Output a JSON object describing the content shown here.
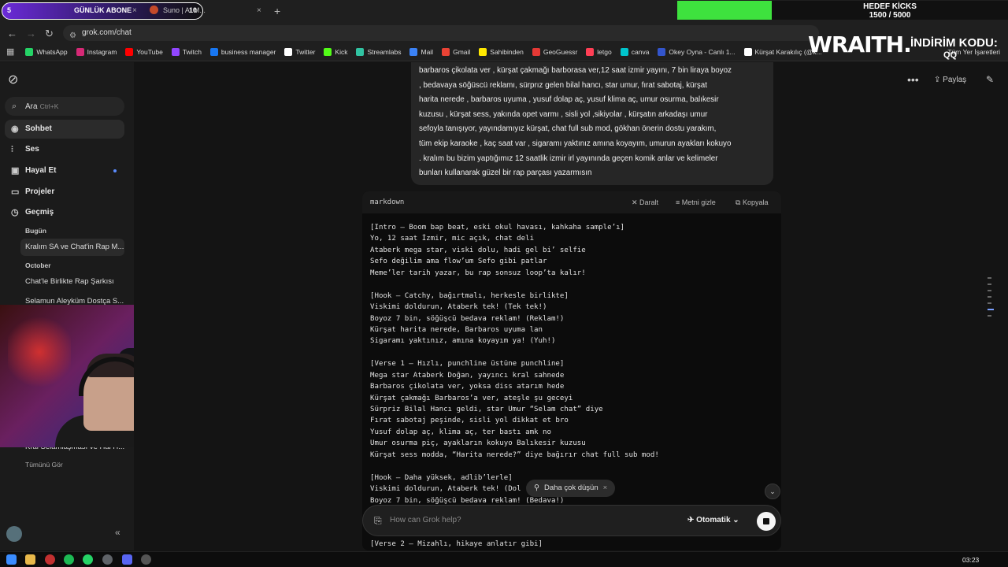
{
  "browser": {
    "tabs": [
      {
        "label": "GÜNLÜK ABONE",
        "count": "5",
        "num": "10"
      },
      {
        "label": "Suno | AI M..."
      }
    ],
    "goal": {
      "title": "HEDEF KİCKS",
      "value": "1500 / 5000",
      "progress": 0.3
    },
    "url": "grok.com/chat",
    "bookmarks": [
      {
        "label": "WhatsApp",
        "icon": "whatsapp-icon",
        "color": "#25d366"
      },
      {
        "label": "Instagram",
        "icon": "instagram-icon",
        "color": "#d62976"
      },
      {
        "label": "YouTube",
        "icon": "youtube-icon",
        "color": "#ff0000"
      },
      {
        "label": "Twitch",
        "icon": "twitch-icon",
        "color": "#9146ff"
      },
      {
        "label": "business manager",
        "icon": "meta-icon",
        "color": "#1877f2"
      },
      {
        "label": "Twitter",
        "icon": "x-icon",
        "color": "#ffffff"
      },
      {
        "label": "Kick",
        "icon": "kick-icon",
        "color": "#53fc18"
      },
      {
        "label": "Streamlabs",
        "icon": "streamlabs-icon",
        "color": "#31c3a2"
      },
      {
        "label": "Mail",
        "icon": "mail-icon",
        "color": "#3b82f6"
      },
      {
        "label": "Gmail",
        "icon": "gmail-icon",
        "color": "#ea4335"
      },
      {
        "label": "Sahibinden",
        "icon": "sahibinden-icon",
        "color": "#ffe800"
      },
      {
        "label": "GeoGuessr",
        "icon": "pin-icon",
        "color": "#e53935"
      },
      {
        "label": "letgo",
        "icon": "letgo-icon",
        "color": "#ff3f55"
      },
      {
        "label": "canva",
        "icon": "canva-icon",
        "color": "#00c4cc"
      },
      {
        "label": "Okey Oyna - Canlı 1...",
        "icon": "okey-icon",
        "color": "#3355cc"
      },
      {
        "label": "Kürşat Karakılıç (@k...",
        "icon": "tiktok-icon",
        "color": "#ffffff"
      }
    ],
    "bookmarks_more": "Tüm Yer İşaretleri"
  },
  "overlay": {
    "brand": "WRAITH.",
    "discount_label": "İNDİRİM KODU:",
    "code": "QQ"
  },
  "sidebar": {
    "search_label": "Ara",
    "search_shortcut": "Ctrl+K",
    "items": [
      {
        "label": "Sohbet",
        "icon": "chat-icon"
      },
      {
        "label": "Ses",
        "icon": "voice-icon"
      },
      {
        "label": "Hayal Et",
        "icon": "imagine-icon"
      },
      {
        "label": "Projeler",
        "icon": "folder-icon"
      },
      {
        "label": "Geçmiş",
        "icon": "history-icon"
      }
    ],
    "group_today": "Bugün",
    "group_october": "October",
    "history": [
      "Kralım SA ve Chat'in Rap M...",
      "Chat'le Birlikte Rap Şarkısı",
      "Selamun Aleyküm Dostça S...",
      "Kral Selamlaşması ve Hal H..."
    ],
    "see_all": "Tümünü Gör"
  },
  "header": {
    "share_label": "Paylaş"
  },
  "user_message": [
    "barbaros çikolata ver , kürşat çakmağı barborasa ver,12 saat izmir yayını, 7 bin liraya boyoz",
    ", bedavaya söğüscü reklamı, sürprız gelen bilal hancı, star umur, fırat sabotaj, kürşat",
    "harita nerede , barbaros uyuma , yusuf dolap aç, yusuf klima aç, umur osurma, balıkesir",
    "kuzusu , kürşat sess, yakında opet varmı , sisli yol ,sikiyolar , kürşatın arkadaşı umur",
    "sefoyla tanışıyor, yayındamıyız kürşat, chat full sub mod, gökhan önerin dostu yarakım,",
    "tüm ekip karaoke , kaç saat var , sigaramı yaktınız amına koyayım, umurun ayakları kokuyo",
    ". kralım bu bizim yaptığımız 12 saatlik izmir irl yayınında geçen komik anlar ve kelimeler",
    "bunları kullanarak güzel bir rap parçası yazarmısın"
  ],
  "code": {
    "language": "markdown",
    "collapse_label": "Daralt",
    "hide_label": "Metni gizle",
    "copy_label": "Kopyala",
    "lines": [
      "[Intro – Boom bap beat, eski okul havası, kahkaha sample’ı]",
      "Yo, 12 saat İzmir, mic açık, chat deli",
      "Ataberk mega star, viski dolu, hadi gel bi’ selfie",
      "Sefo değilim ama flow’um Sefo gibi patlar",
      "Meme’ler tarih yazar, bu rap sonsuz loop’ta kalır!",
      "",
      "[Hook – Catchy, bağırtmalı, herkesle birlikte]",
      "Viskimi doldurun, Ataberk tek! (Tek tek!)",
      "Boyoz 7 bin, söğüşcü bedava reklam! (Reklam!)",
      "Kürşat harita nerede, Barbaros uyuma lan",
      "Sigaramı yaktınız, amına koyayım ya! (Yuh!)",
      "",
      "[Verse 1 – Hızlı, punchline üstüne punchline]",
      "Mega star Ataberk Doğan, yayıncı kral sahnede",
      "Barbaros çikolata ver, yoksa diss atarım hede",
      "Kürşat çakmağı Barbaros’a ver, ateşle şu geceyi",
      "Sürpriz Bilal Hancı geldi, star Umur “Selam chat” diye",
      "Fırat sabotaj peşinde, sisli yol dikkat et bro",
      "Yusuf dolap aç, klima aç, ter bastı amk no",
      "Umur osurma piç, ayakların kokuyo Balıkesir kuzusu",
      "Kürşat sess modda, “Harita nerede?” diye bağırır chat full sub mod!",
      "",
      "[Hook – Daha yüksek, adlib’lerle]",
      "Viskimi doldurun, Ataberk tek! (Dol",
      "Boyoz 7 bin, söğüşcü bedava reklam! (Bedava!)"
    ],
    "tail_line": "[Verse 2 – Mizahlı, hikaye anlatır gibi]"
  },
  "tooltip": {
    "label": "Daha çok düşün"
  },
  "composer": {
    "placeholder": "How can Grok help?",
    "mode_label": "Otomatik"
  },
  "taskbar": {
    "clock": "03:23"
  }
}
